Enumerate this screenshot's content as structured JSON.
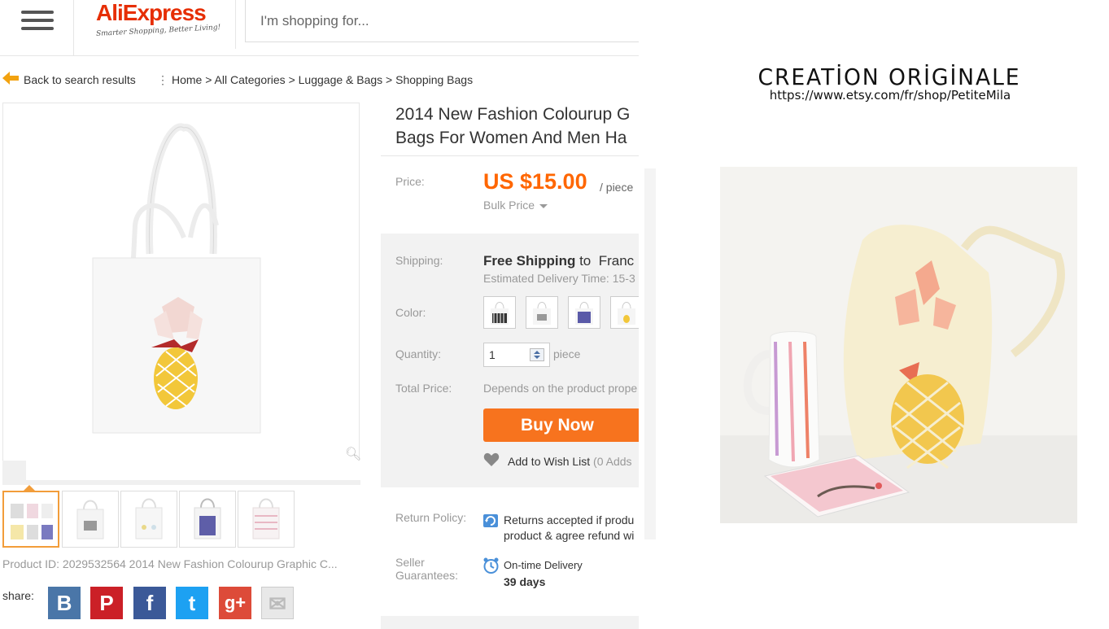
{
  "header": {
    "menu_icon": "hamburger-icon",
    "logo_text": "AliExpress",
    "logo_tagline": "Smarter Shopping, Better Living!",
    "search_placeholder": "I'm shopping for..."
  },
  "breadcrumb": {
    "back_label": "Back to search results",
    "separator": "⋮",
    "path": "Home > All Categories > Luggage & Bags > Shopping Bags"
  },
  "gallery": {
    "zoom_icon": "magnifier-icon",
    "thumbnail_count": 5,
    "selected_thumbnail": 1
  },
  "product": {
    "id_line": "Product ID: 2029532564 2014 New Fashion Colourup Graphic C...",
    "title_line1": "2014 New Fashion Colourup G",
    "title_line2": "Bags For Women And Men Ha",
    "price_label": "Price:",
    "price_value": "US $15.00",
    "price_unit": "/ piece",
    "bulk_price": "Bulk Price",
    "shipping_label": "Shipping:",
    "shipping_free": "Free Shipping",
    "shipping_to": " to  Franc",
    "estimated": "Estimated Delivery Time: 15-3",
    "color_label": "Color:",
    "quantity_label": "Quantity:",
    "quantity_value": "1",
    "quantity_unit": "piece",
    "total_label": "Total Price:",
    "total_value": "Depends on the product prope",
    "buy_now": "Buy Now",
    "wishlist_label": "Add to Wish List",
    "wishlist_count": "(0 Adds",
    "return_label": "Return Policy:",
    "return_line1": "Returns accepted if produ",
    "return_line2": "product & agree refund wi",
    "guarantee_label_1": "Seller",
    "guarantee_label_2": "Guarantees:",
    "guarantee_line1": "On-time Delivery",
    "guarantee_line2": "39 days"
  },
  "share": {
    "label": "share:",
    "buttons": [
      {
        "name": "vk",
        "glyph": "B",
        "color": "#4a76a8"
      },
      {
        "name": "pinterest",
        "glyph": "P",
        "color": "#cb2027"
      },
      {
        "name": "facebook",
        "glyph": "f",
        "color": "#3b5998"
      },
      {
        "name": "twitter",
        "glyph": "t",
        "color": "#1da1f2"
      },
      {
        "name": "google-plus",
        "glyph": "g+",
        "color": "#dd4b39"
      },
      {
        "name": "email",
        "glyph": "✉",
        "color": "#e8e8e8"
      }
    ]
  },
  "right_panel": {
    "heading": "CREATİON ORİGİNALE",
    "url": "https://www.etsy.com/fr/shop/PetiteMila"
  },
  "colors": {
    "brand": "#e62e04",
    "price": "#ff6600",
    "buy_button": "#f7731e",
    "panel_bg": "#f2f2f2"
  }
}
